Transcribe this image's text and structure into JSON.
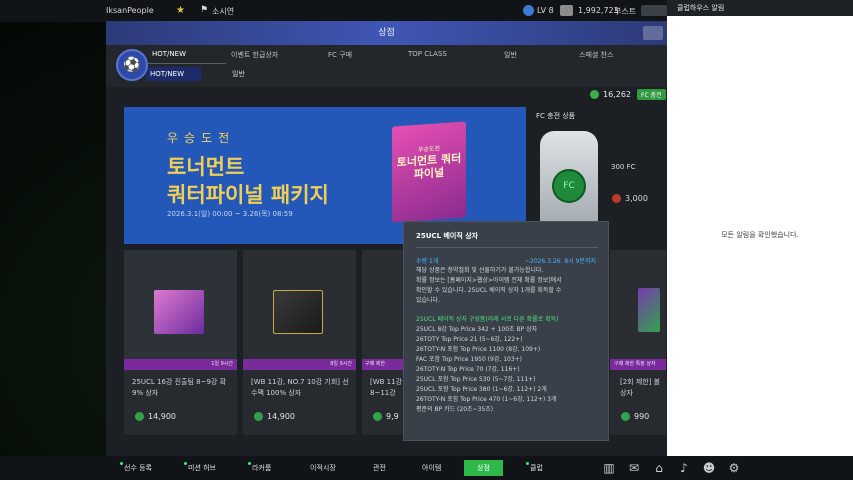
{
  "topbar": {
    "username": "IksanPeople",
    "summon_label": "소시연",
    "level": "LV 8",
    "coins": "1,992,723",
    "boost_label": "부스트"
  },
  "shop": {
    "title": "상점",
    "tabs": [
      "HOT/NEW",
      "이벤트 한급상자",
      "FC 구매",
      "TOP CLASS",
      "일반",
      "스페셜 찬스"
    ],
    "subtabs": [
      "HOT/NEW",
      "일반"
    ],
    "fc_balance": "16,262",
    "fc_charge_label": "FC 충전"
  },
  "banner": {
    "subtitle": "우승도전",
    "title_line1": "토너먼트",
    "title_line2": "쿼터파이널 패키지",
    "date": "2026.3.1(일) 00:00 ~ 3.26(목) 08:59",
    "pack_sub": "우승도전",
    "pack_title": "토너먼트 쿼터파이널"
  },
  "fc_charge": {
    "title": "FC 충전 상품",
    "coin_label": "FC",
    "amount": "300 FC",
    "price": "3,000"
  },
  "products": [
    {
      "timer": "1일 9시간",
      "name": "25UCL 16강 진출팀 8~9강 확 9% 상자",
      "price": "14,900"
    },
    {
      "timer": "8일 9시간",
      "name": "[WB 11강, NO.7 10강 기회] 선수팩 100% 상자",
      "price": "14,900"
    },
    {
      "timer": "구매 제한",
      "name": "[WB 11강 8~11강",
      "price": "9,9"
    },
    {
      "timer": "구매 제한 특정 상자",
      "name": "[2회 제한] 볼 상자",
      "price": "990"
    }
  ],
  "tooltip": {
    "title": "25UCL 베이직 상자",
    "quantity": "수량 1개",
    "until": "~2026.3.26. 8시 9분까지",
    "desc": [
      "해당 상품은 청약철회 및 선물하기가 불가능합니다.",
      "확률 정보는 [홈페이지>웹상>아이템 전체 확률 정보]에서",
      "확인할 수 있습니다. 25UCL 베이직 상자 1개를 획득할 수",
      "있습니다."
    ],
    "composition_title": "25UCL 베이직 상자 구성품(아래 서로 다른 확률로 획득)",
    "items": [
      "25UCL 8강 Top Price 342 + 100조 BP 상자",
      "26TOTY Top Price 21 (5~6강, 122+)",
      "26TOTY-N 포함 Top Price 1100 (8강, 109+)",
      "FAC 포함 Top Price 1950 (9강, 103+)",
      "26TOTY-N Top Price 70 (7강, 116+)",
      "25UCL 포함 Top Price 530 (5~7강, 111+)",
      "25UCL 포함 Top Price 380 (1~6강, 112+) 2개",
      "26TOTY-N 포함 Top Price 470 (1~6강, 112+) 3개",
      "평준의 BP 카드 (20조~35조)"
    ]
  },
  "notifications": {
    "title": "클럽하우스 알림",
    "empty_message": "모든 알림을 확인했습니다."
  },
  "bottom_nav": [
    "선수 등록",
    "미션 허브",
    "라커룸",
    "이적시장",
    "관전",
    "아이템",
    "상점",
    "클럽"
  ],
  "colors": {
    "accent": "#2fb84a",
    "header": "#3f56b4",
    "tooltip_link": "#48b4ff",
    "composition": "#4ee07a"
  }
}
